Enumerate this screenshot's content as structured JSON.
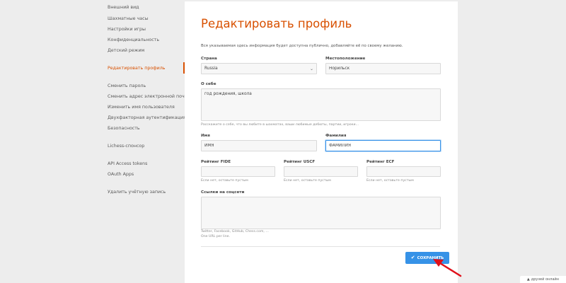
{
  "sidebar": {
    "items": [
      {
        "label": "Внешний вид",
        "active": false
      },
      {
        "label": "Шахматные часы",
        "active": false
      },
      {
        "label": "Настройки игры",
        "active": false
      },
      {
        "label": "Конфиденциальность",
        "active": false
      },
      {
        "label": "Детский режим",
        "active": false
      },
      {
        "label": "Редактировать профиль",
        "active": true
      },
      {
        "label": "Сменить пароль",
        "active": false
      },
      {
        "label": "Сменить адрес электронной почты",
        "active": false
      },
      {
        "label": "Изменить имя пользователя",
        "active": false
      },
      {
        "label": "Двухфакторная аутентификация",
        "active": false
      },
      {
        "label": "Безопасность",
        "active": false
      },
      {
        "label": "Lichess-спонсор",
        "active": false
      },
      {
        "label": "API Access tokens",
        "active": false
      },
      {
        "label": "OAuth Apps",
        "active": false
      },
      {
        "label": "Удалить учётную запись",
        "active": false
      }
    ]
  },
  "profile": {
    "title": "Редактировать профиль",
    "intro": "Вся указываемая здесь информация будет доступна публично, добавляйте её по своему желанию.",
    "country": {
      "label": "Страна",
      "value": "Russia"
    },
    "location": {
      "label": "Местоположение",
      "value": "Норильск"
    },
    "bio": {
      "label": "О себе",
      "value": "год рождения, школа",
      "hint": "Расскажите о себе, что вы любите в шахматах, ваши любимые дебюты, партии, игроки..."
    },
    "first_name": {
      "label": "Имя",
      "value": "ИМЯ"
    },
    "last_name": {
      "label": "Фамилия",
      "value": "ФАМИЛИЯ"
    },
    "fide": {
      "label": "Рейтинг FIDE",
      "value": "",
      "hint": "Если нет, оставьте пустым"
    },
    "uscf": {
      "label": "Рейтинг USCF",
      "value": "",
      "hint": "Если нет, оставьте пустым"
    },
    "ecf": {
      "label": "Рейтинг ECF",
      "value": "",
      "hint": "Если нет, оставьте пустым"
    },
    "links": {
      "label": "Ссылки на соцсети",
      "value": "",
      "hint1": "Twitter, Facebook, GitHub, Chess.com, ...",
      "hint2": "One URL per line."
    },
    "save_label": "СОХРАНИТЬ"
  },
  "friends_label": "друзей онлайн",
  "colors": {
    "accent": "#d85000",
    "button": "#3692e7",
    "arrow": "#e0101a"
  }
}
